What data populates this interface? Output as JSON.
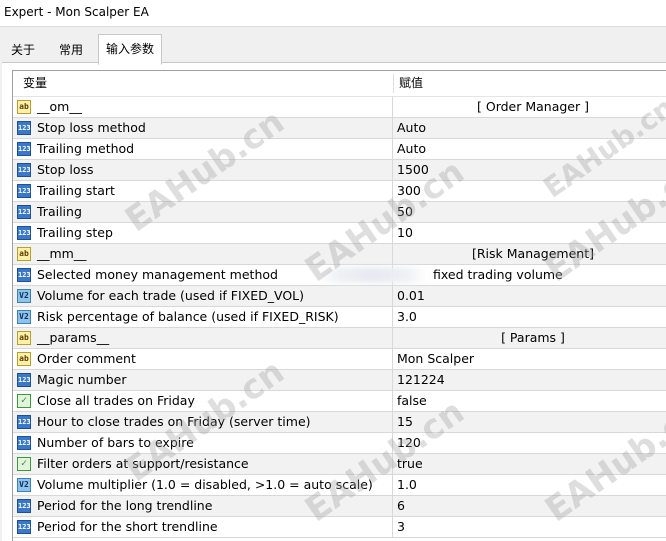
{
  "window": {
    "title": "Expert - Mon Scalper EA"
  },
  "tabs": [
    {
      "label": "关于",
      "active": false
    },
    {
      "label": "常用",
      "active": false
    },
    {
      "label": "输入参数",
      "active": true
    }
  ],
  "grid": {
    "columns": {
      "variable": "变量",
      "value": "赋值"
    },
    "rows": [
      {
        "type": "string",
        "name": "__om__",
        "value": "[ Order Manager ]"
      },
      {
        "type": "int",
        "name": "Stop loss method",
        "value": "Auto"
      },
      {
        "type": "int",
        "name": "Trailing method",
        "value": "Auto"
      },
      {
        "type": "int",
        "name": "Stop loss",
        "value": "1500"
      },
      {
        "type": "int",
        "name": "Trailing start",
        "value": "300"
      },
      {
        "type": "int",
        "name": "Trailing",
        "value": "50"
      },
      {
        "type": "int",
        "name": "Trailing step",
        "value": "10"
      },
      {
        "type": "string",
        "name": "__mm__",
        "value": "[Risk Management]"
      },
      {
        "type": "int",
        "name": "Selected money management method",
        "value": "fixed trading volume"
      },
      {
        "type": "double",
        "name": "Volume for each trade (used if FIXED_VOL)",
        "value": "0.01"
      },
      {
        "type": "double",
        "name": "Risk percentage of balance (used if FIXED_RISK)",
        "value": "3.0"
      },
      {
        "type": "string",
        "name": "__params__",
        "value": "[ Params ]"
      },
      {
        "type": "string",
        "name": "Order comment",
        "value": "Mon Scalper"
      },
      {
        "type": "int",
        "name": "Magic number",
        "value": "121224"
      },
      {
        "type": "bool",
        "name": "Close all trades on Friday",
        "value": "false"
      },
      {
        "type": "int",
        "name": "Hour to close trades on Friday (server time)",
        "value": "15"
      },
      {
        "type": "int",
        "name": "Number of bars to expire",
        "value": "120"
      },
      {
        "type": "bool",
        "name": "Filter orders at support/resistance",
        "value": "true"
      },
      {
        "type": "double",
        "name": "Volume multiplier (1.0 = disabled, >1.0 = auto scale)",
        "value": "1.0"
      },
      {
        "type": "int",
        "name": "Period for the long trendline",
        "value": "6"
      },
      {
        "type": "int",
        "name": "Period for the short trendline",
        "value": "3"
      }
    ]
  },
  "icons": {
    "int": "int-type-icon",
    "string": "string-type-icon",
    "double": "double-type-icon",
    "bool": "bool-type-icon"
  },
  "watermark": "EAHub.cn"
}
